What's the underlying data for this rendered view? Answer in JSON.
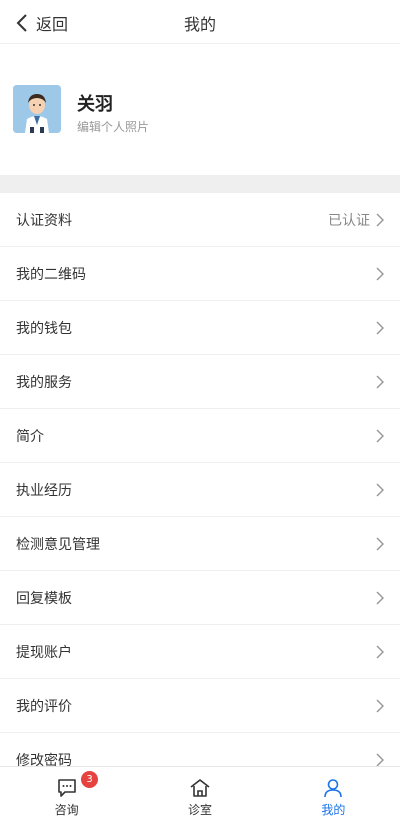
{
  "header": {
    "back_label": "返回",
    "title": "我的"
  },
  "profile": {
    "name": "关羽",
    "edit_photo_label": "编辑个人照片"
  },
  "menu": {
    "items": [
      {
        "label": "认证资料",
        "value": "已认证"
      },
      {
        "label": "我的二维码"
      },
      {
        "label": "我的钱包"
      },
      {
        "label": "我的服务"
      },
      {
        "label": "简介"
      },
      {
        "label": "执业经历"
      },
      {
        "label": "检测意见管理"
      },
      {
        "label": "回复模板"
      },
      {
        "label": "提现账户"
      },
      {
        "label": "我的评价"
      },
      {
        "label": "修改密码"
      }
    ]
  },
  "tabbar": {
    "tabs": [
      {
        "label": "咨询",
        "icon": "chat-icon",
        "badge": "3"
      },
      {
        "label": "诊室",
        "icon": "home-icon"
      },
      {
        "label": "我的",
        "icon": "user-icon",
        "active": true
      }
    ]
  },
  "colors": {
    "accent": "#1a73e8",
    "badge": "#e64340",
    "divider": "#efefef"
  }
}
